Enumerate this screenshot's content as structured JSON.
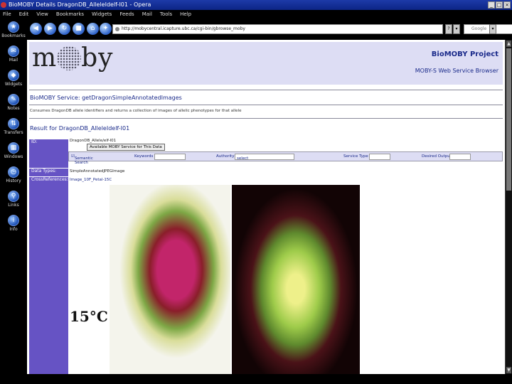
{
  "window": {
    "title": "BioMOBY Details DragonDB_AlleleIdelf-I01 - Opera",
    "buttons": [
      "_",
      "□",
      "×"
    ]
  },
  "menu": [
    "File",
    "Edit",
    "View",
    "Bookmarks",
    "Widgets",
    "Feeds",
    "Mail",
    "Tools",
    "Help"
  ],
  "sidebar": [
    {
      "label": "Bookmarks",
      "icon": "bookmark-icon",
      "glyph": "★"
    },
    {
      "label": "Mail",
      "icon": "mail-icon",
      "glyph": "✉"
    },
    {
      "label": "Widgets",
      "icon": "widgets-icon",
      "glyph": "◆"
    },
    {
      "label": "Notes",
      "icon": "notes-icon",
      "glyph": "✎"
    },
    {
      "label": "Transfers",
      "icon": "transfers-icon",
      "glyph": "⇅"
    },
    {
      "label": "Windows",
      "icon": "windows-icon",
      "glyph": "▦"
    },
    {
      "label": "History",
      "icon": "history-icon",
      "glyph": "◷"
    },
    {
      "label": "Links",
      "icon": "links-icon",
      "glyph": "⚲"
    },
    {
      "label": "Info",
      "icon": "info-icon",
      "glyph": "i"
    }
  ],
  "nav": {
    "address": "http://mobycentral.icapture.ubc.ca/cgi-bin/gbrowse_moby",
    "search_placeholder": "Google"
  },
  "page": {
    "project": "BioMOBY Project",
    "browser_name": "MOBY-S Web Service Browser",
    "service_title": "BioMOBY Service: getDragonSimpleAnnotatedImages",
    "service_desc": "Consumes DragonDB allele identifiers and returns a collection of images of allelic phenotypes for that allele",
    "result_title": "Result for DragonDB_AlleleIdelf-I01",
    "id_label": "ID:",
    "id_value": "DragonDB_Allele/elf-I01",
    "moby_button": "Available MOBY Service for This Data",
    "form": {
      "semantic": "Semantic Search",
      "keywords": "Keywords",
      "authority": "Authority",
      "authority_value": "select",
      "service_type": "Service Type",
      "output": "Desired Output"
    },
    "data_type_label": "Data Types:",
    "data_type_value": "SimpleAnnotatedJPEGImage",
    "cross_ref_label": "CrossReferences:",
    "cross_ref_value": "Image_10F_Petal-15C",
    "photo_caption": "15°C"
  }
}
